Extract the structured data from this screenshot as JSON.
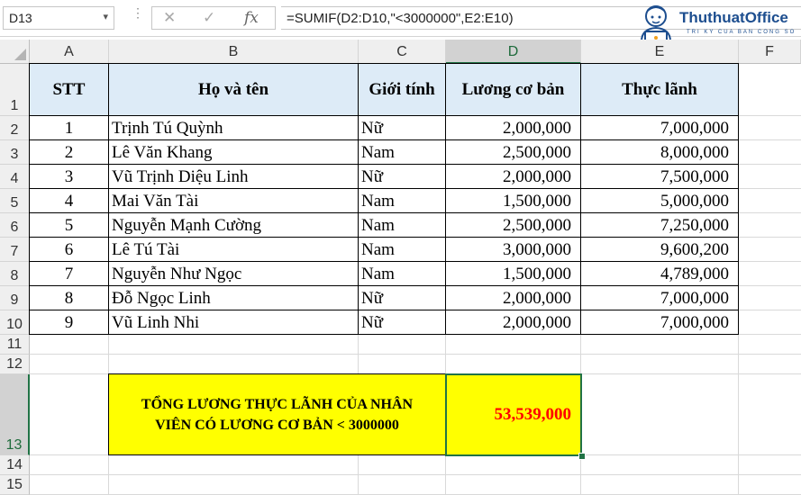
{
  "formula_bar": {
    "name_box": "D13",
    "name_box_arrow": "▾",
    "cancel_icon": "✕",
    "enter_icon": "✓",
    "fx_label": "fx",
    "formula": "=SUMIF(D2:D10,\"<3000000\",E2:E10)"
  },
  "logo": {
    "name": "ThuthuatOffice",
    "tagline": "TRI KY CUA BAN CONG SO"
  },
  "columns": [
    "A",
    "B",
    "C",
    "D",
    "E",
    "F"
  ],
  "selected_column": "D",
  "rows": [
    "1",
    "2",
    "3",
    "4",
    "5",
    "6",
    "7",
    "8",
    "9",
    "10",
    "11",
    "12",
    "13",
    "14",
    "15"
  ],
  "selected_row": "13",
  "table": {
    "headers": [
      "STT",
      "Họ và tên",
      "Giới tính",
      "Lương cơ bản",
      "Thực lãnh"
    ],
    "records": [
      [
        "1",
        "Trịnh Tú Quỳnh",
        "Nữ",
        "2,000,000",
        "7,000,000"
      ],
      [
        "2",
        "Lê Văn Khang",
        "Nam",
        "2,500,000",
        "8,000,000"
      ],
      [
        "3",
        "Vũ Trịnh Diệu Linh",
        "Nữ",
        "2,000,000",
        "7,500,000"
      ],
      [
        "4",
        "Mai Văn Tài",
        "Nam",
        "1,500,000",
        "5,000,000"
      ],
      [
        "5",
        "Nguyễn Mạnh Cường",
        "Nam",
        "2,500,000",
        "7,250,000"
      ],
      [
        "6",
        "Lê Tú Tài",
        "Nam",
        "3,000,000",
        "9,600,200"
      ],
      [
        "7",
        "Nguyễn Như Ngọc",
        "Nam",
        "1,500,000",
        "4,789,000"
      ],
      [
        "8",
        "Đỗ Ngọc Linh",
        "Nữ",
        "2,000,000",
        "7,000,000"
      ],
      [
        "9",
        "Vũ Linh Nhi",
        "Nữ",
        "2,000,000",
        "7,000,000"
      ]
    ]
  },
  "summary": {
    "label_line1": "TỔNG LƯƠNG THỰC LÃNH CỦA NHÂN",
    "label_line2": "VIÊN CÓ LƯƠNG CƠ BẢN < 3000000",
    "value": "53,539,000",
    "label_color": "#ffff00",
    "value_color": "#ff0000"
  },
  "colors": {
    "header_fill": "#ddebf7",
    "selection": "#217346"
  }
}
